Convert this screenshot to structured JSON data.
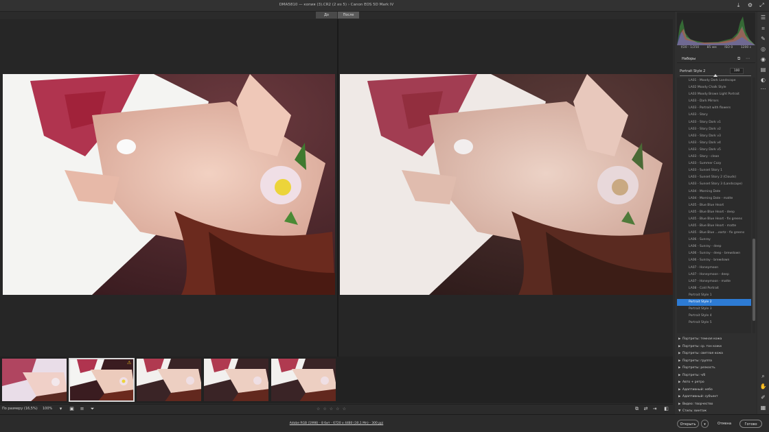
{
  "window": {
    "title": "DMA5810 — копия (3).CR2 (2 из 5)   ›   Canon EOS 5D Mark IV",
    "icons": [
      "save-icon",
      "settings-icon",
      "fullscreen-icon"
    ]
  },
  "compare_tabs": {
    "before": "До",
    "after": "После"
  },
  "viewbar": {
    "zoom_select": "По размеру (16,5%)",
    "zoom_100": "100%",
    "stars": [
      "☆",
      "☆",
      "☆",
      "☆",
      "☆"
    ]
  },
  "workflow_link": "Adobe RGB (1998) - 8 бит - 6720 х 4480 (30,1 Мп) - 300 ppi",
  "buttons": {
    "open": "Открыть",
    "cancel": "Отмена",
    "done": "Готово"
  },
  "histogram": {
    "readout": [
      "f/20 - 1/250",
      "85 мм",
      "ISO 0",
      "1200 с"
    ]
  },
  "presets": {
    "header": "Наборы",
    "current_name": "Portrait Style 2",
    "amount": "100",
    "amount_fraction": 0.5,
    "items": [
      "LA01 - Moody Dark Landscape",
      "LA02 Moody Chalk Style",
      "LA03 Moody Brown Light Portrait",
      "LA03 - Dark Mirrors",
      "LA03 - Portrait with flowers",
      "LA03 - Story",
      "LA03 - Story Dark v1",
      "LA03 - Story Dark v2",
      "LA03 - Story Dark v3",
      "LA03 - Story Dark v4",
      "LA03 - Story Dark v5",
      "LA03 - Story - clean",
      "LA03 - Summer Cozy",
      "LA03 - Sunset Story 1",
      "LA03 - Sunset Story 2 (Clouds)",
      "LA03 - Sunset Story 3 (Landscape)",
      "LA04 - Morning Date",
      "LA04 - Morning Date - matte",
      "LA05 - Blue Blue Heart",
      "LA05 - Blue Blue Heart - deep",
      "LA05 - Blue Blue Heart - fix greens",
      "LA05 - Blue Blue Heart - matte",
      "LA05 - Blue Blue ...eartz - fix greens",
      "LA06 - Sunray",
      "LA06 - Sunray - deep",
      "LA06 - Sunray - deep - brewdown",
      "LA06 - Sunray - brewdown",
      "LA07 - Honeymoon",
      "LA07 - Honeymoon - deep",
      "LA07 - Honeymoon - matte",
      "LA08 - Cold Portrait",
      "Portrait Style 1",
      "Portrait Style 2",
      "Portrait Style 3",
      "Portrait Style 4",
      "Portrait Style 5"
    ],
    "selected_index": 32,
    "groups": [
      {
        "label": "Портреты: темная кожа",
        "expanded": false
      },
      {
        "label": "Портреты: ср. тон кожи",
        "expanded": false
      },
      {
        "label": "Портреты: светлая кожа",
        "expanded": false
      },
      {
        "label": "Портреты: группа",
        "expanded": false
      },
      {
        "label": "Портреты: резкость",
        "expanded": false
      },
      {
        "label": "Портреты: ч/б",
        "expanded": false
      },
      {
        "label": "Авто + ретро",
        "expanded": false
      },
      {
        "label": "Адаптивный: небо",
        "expanded": false
      },
      {
        "label": "Адаптивный: субъект",
        "expanded": false
      },
      {
        "label": "Видео: творчество",
        "expanded": false
      },
      {
        "label": "Стиль: винтаж",
        "expanded": true
      }
    ]
  },
  "filmstrip": {
    "selected_index": 1,
    "warning": "⚠"
  },
  "colors": {
    "accent": "#2d7bd4",
    "warning": "#f0c020"
  }
}
